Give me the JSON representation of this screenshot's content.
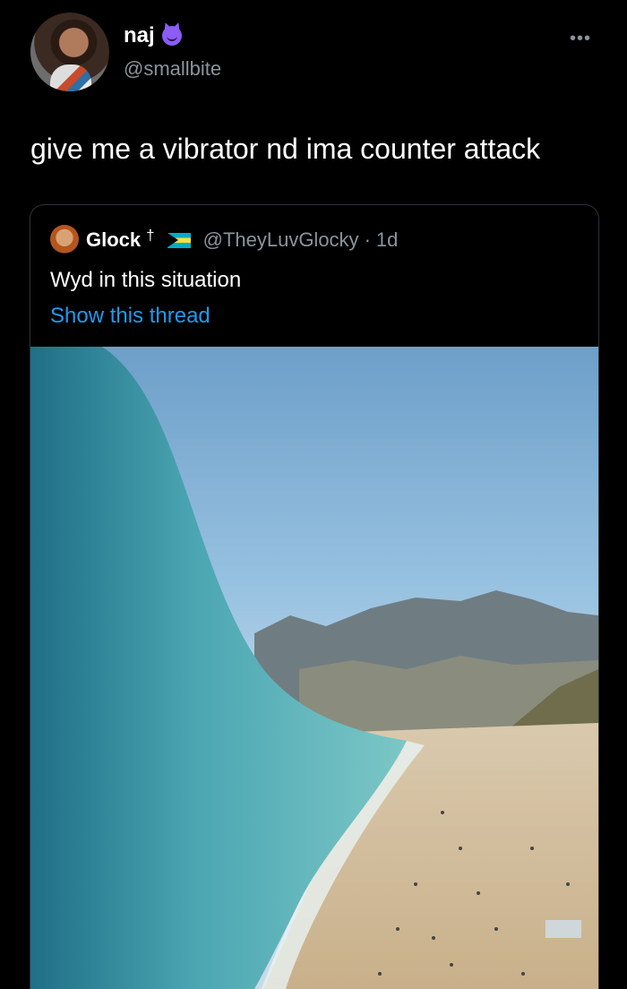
{
  "author": {
    "name": "naj",
    "handle": "@smallbite",
    "badge_icon": "smiling-devil-icon"
  },
  "tweet": {
    "text": "give me a vibrator nd ima counter attack",
    "menu_icon": "more-icon"
  },
  "quoted": {
    "name": "Glock",
    "name_suffix": "†",
    "flag_icon": "bahamas-flag-icon",
    "handle": "@TheyLuvGlocky",
    "separator": "·",
    "time": "1d",
    "text": "Wyd in this situation",
    "link": "Show this thread",
    "image_icon": "giant-wave-beach-photo"
  },
  "colors": {
    "background": "#000000",
    "link": "#1d9bf0",
    "muted": "#8b949b",
    "border": "#2f3336"
  }
}
